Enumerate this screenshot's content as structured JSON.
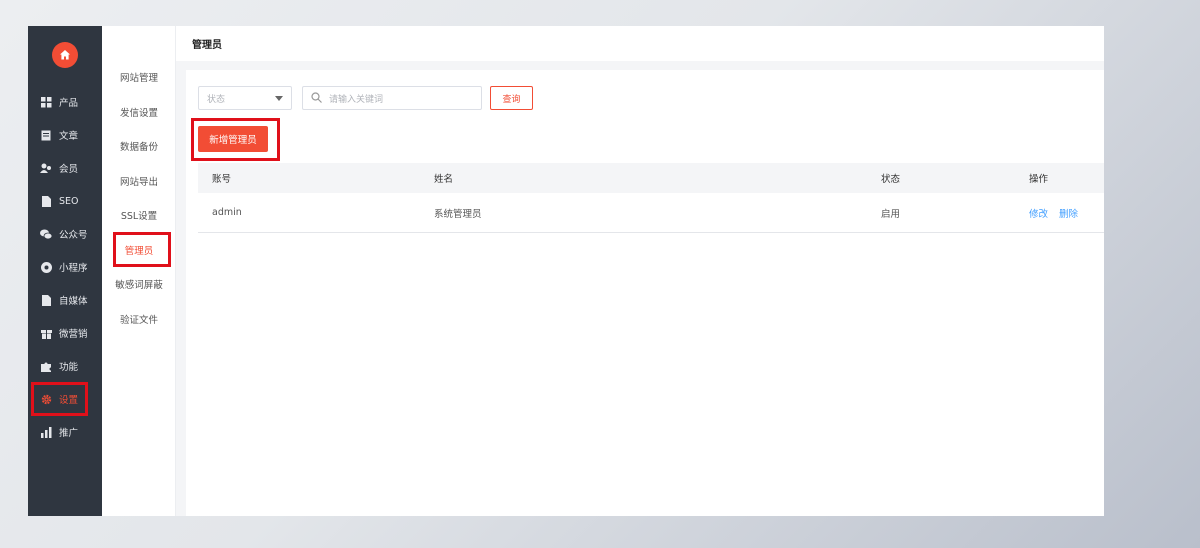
{
  "colors": {
    "accent": "#f24d35",
    "sidebar_bg": "#2f3640",
    "link": "#409eff",
    "highlight": "#e0101a"
  },
  "sidebar": {
    "logo_icon": "home-icon",
    "items": [
      {
        "label": "产品",
        "icon": "grid-icon"
      },
      {
        "label": "文章",
        "icon": "document-icon"
      },
      {
        "label": "会员",
        "icon": "users-icon"
      },
      {
        "label": "SEO",
        "icon": "file-icon"
      },
      {
        "label": "公众号",
        "icon": "wechat-icon"
      },
      {
        "label": "小程序",
        "icon": "miniprogram-icon"
      },
      {
        "label": "自媒体",
        "icon": "file-icon"
      },
      {
        "label": "微营销",
        "icon": "gift-icon"
      },
      {
        "label": "功能",
        "icon": "puzzle-icon"
      },
      {
        "label": "设置",
        "icon": "gear-icon",
        "active": true
      },
      {
        "label": "推广",
        "icon": "chart-icon"
      }
    ]
  },
  "submenu": {
    "items": [
      {
        "label": "网站管理"
      },
      {
        "label": "发信设置"
      },
      {
        "label": "数据备份"
      },
      {
        "label": "网站导出"
      },
      {
        "label": "SSL设置"
      },
      {
        "label": "管理员",
        "active": true
      },
      {
        "label": "敏感词屏蔽"
      },
      {
        "label": "验证文件"
      }
    ]
  },
  "header": {
    "title": "管理员"
  },
  "filters": {
    "status_placeholder": "状态",
    "search_placeholder": "请输入关键词",
    "query_label": "查询"
  },
  "add_button_label": "新增管理员",
  "table": {
    "columns": [
      "账号",
      "姓名",
      "状态",
      "操作"
    ],
    "rows": [
      {
        "account": "admin",
        "name": "系统管理员",
        "status": "启用",
        "edit": "修改",
        "delete": "删除"
      }
    ]
  }
}
